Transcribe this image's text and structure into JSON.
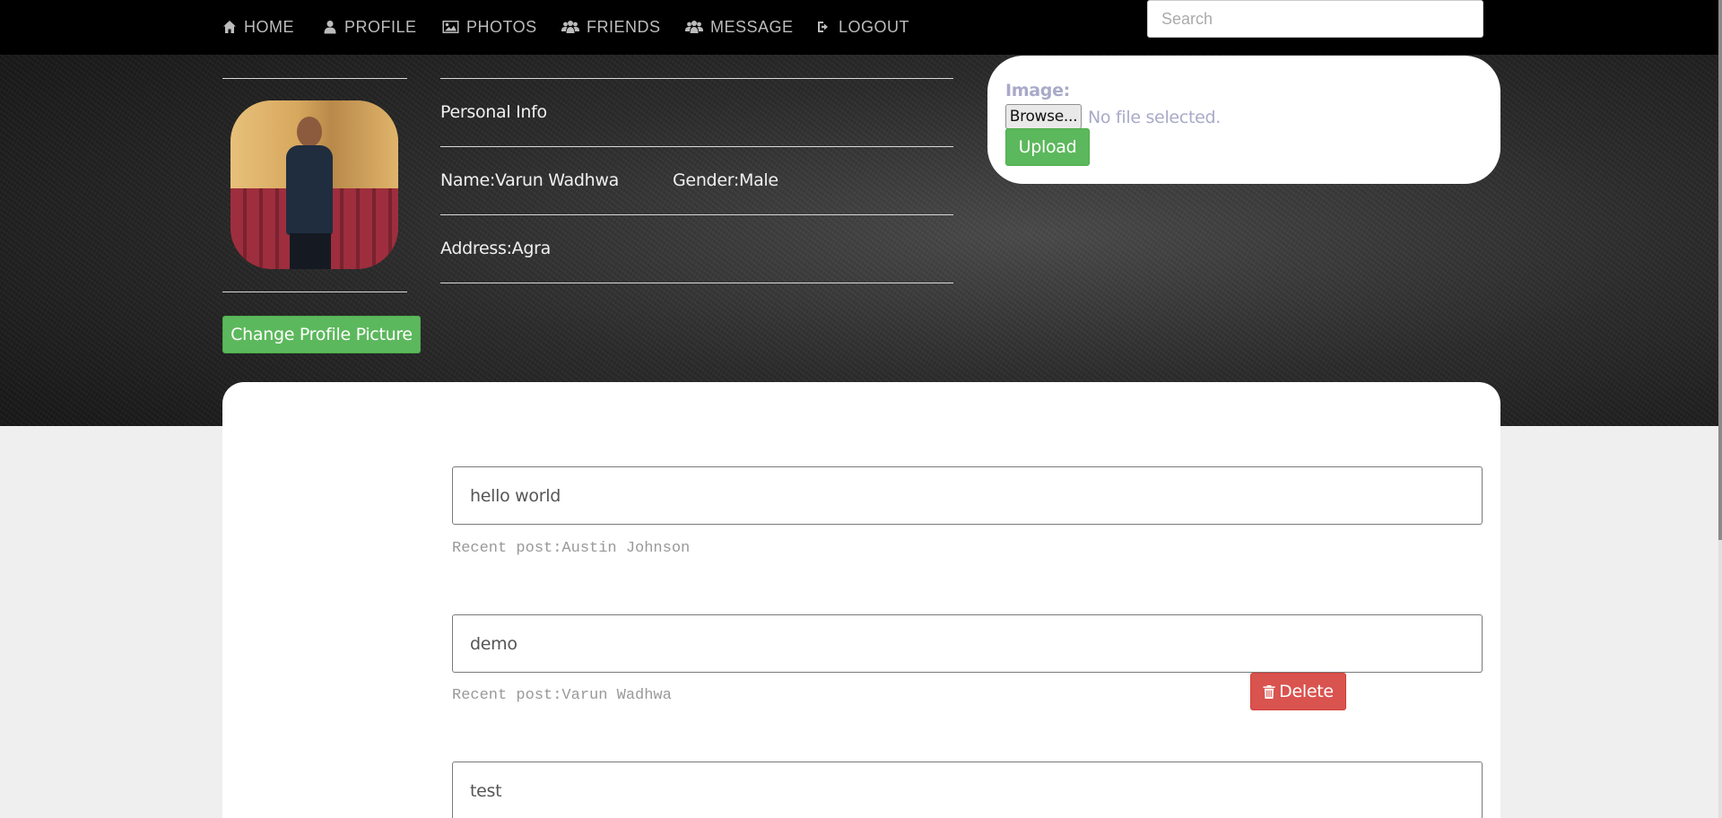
{
  "nav": {
    "items": [
      {
        "label": "HOME",
        "icon": "home-icon"
      },
      {
        "label": "PROFILE",
        "icon": "user-icon"
      },
      {
        "label": "PHOTOS",
        "icon": "picture-icon"
      },
      {
        "label": "FRIENDS",
        "icon": "users-icon"
      },
      {
        "label": "MESSAGE",
        "icon": "users-icon"
      },
      {
        "label": "LOGOUT",
        "icon": "logout-icon"
      }
    ],
    "search_placeholder": "Search"
  },
  "profile": {
    "section_title": "Personal Info",
    "name": "Name:Varun Wadhwa",
    "gender": "Gender:Male",
    "address": "Address:Agra",
    "change_picture_label": "Change Profile Picture"
  },
  "upload": {
    "label": "Image:",
    "browse_label": "Browse...",
    "no_file_text": "No file selected.",
    "upload_label": "Upload"
  },
  "posts": [
    {
      "text": "hello world",
      "meta": "Recent post:Austin Johnson"
    },
    {
      "text": "demo",
      "meta": "Recent post:Varun Wadhwa",
      "delete_label": "Delete"
    },
    {
      "text": "test"
    }
  ],
  "colors": {
    "navbar": "#000000",
    "success": "#5cb85c",
    "danger": "#d9534f",
    "nav_text": "#bcbcbc"
  }
}
